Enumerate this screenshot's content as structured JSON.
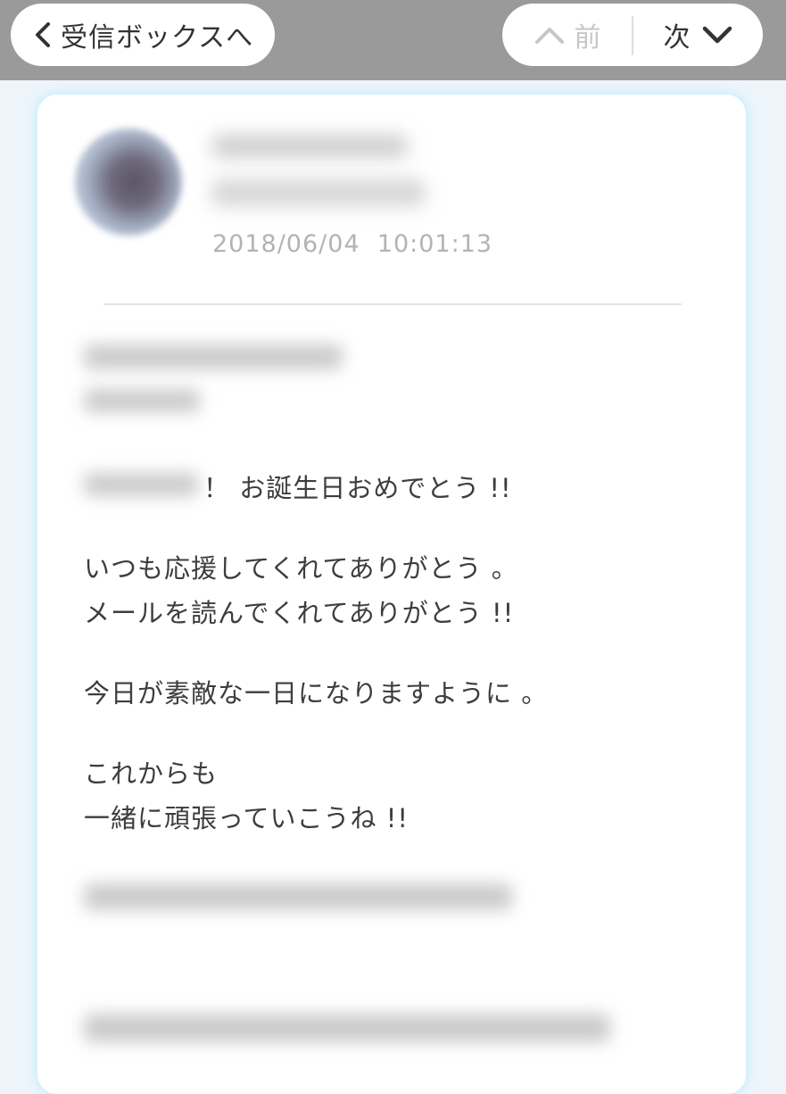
{
  "header": {
    "back_label": "受信ボックスへ",
    "prev_label": "前",
    "next_label": "次"
  },
  "message": {
    "timestamp": "2018/06/04  10:01:13",
    "lines": [
      "！ お誕生日おめでとう !!",
      "いつも応援してくれてありがとう 。",
      "メールを読んでくれてありがとう !!",
      "今日が素敵な一日になりますように 。",
      "これからも",
      "一緒に頑張っていこうね !!"
    ]
  },
  "colors": {
    "topbar": "#9a9a9a",
    "card_glow": "#cfeeff",
    "text": "#3d3d3d",
    "timestamp": "#b3b3b3",
    "disabled": "#c6c6c6"
  }
}
